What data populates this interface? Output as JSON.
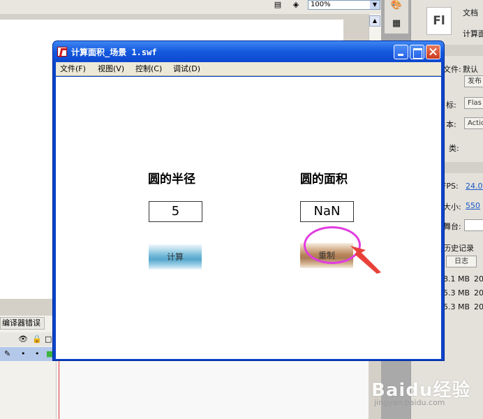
{
  "ide": {
    "zoom": "100%",
    "panel": {
      "logo": "Fl",
      "doc_label": "文档",
      "doc_name": "计算面",
      "publish_file_label": "文件:",
      "publish_file_value": "默认",
      "publish_button": "发布",
      "player_label": "标:",
      "player_value": "Flas",
      "script_label": "本:",
      "script_value": "Actio",
      "class_label": "类:",
      "fps_label": "FPS:",
      "fps_value": "24.00",
      "size_label": "大小:",
      "size_value": "550",
      "stage_label": "舞台:",
      "history_label": "历史记录",
      "log_button": "日志",
      "history_rows": [
        {
          "size": "8.1 MB",
          "date": "20"
        },
        {
          "size": "5.3 MB",
          "date": "20"
        },
        {
          "size": "5.3 MB",
          "date": "20"
        }
      ]
    },
    "compiler_tab": "编译器错误"
  },
  "swf_window": {
    "title": "计算面积_场景 1.swf",
    "menu": [
      "文件(F)",
      "视图(V)",
      "控制(C)",
      "调试(D)"
    ]
  },
  "app": {
    "radius_label": "圆的半径",
    "radius_value": "5",
    "area_label": "圆的面积",
    "area_value": "NaN",
    "calc_button": "计算",
    "reset_button": "重制"
  },
  "watermark": {
    "logo": "Baidu经验",
    "sub": "jingyan.baidu.com"
  },
  "colors": {
    "annotation_ellipse": "#e13ce0",
    "annotation_arrow": "#e8413a",
    "titlebar": "#1459df"
  }
}
